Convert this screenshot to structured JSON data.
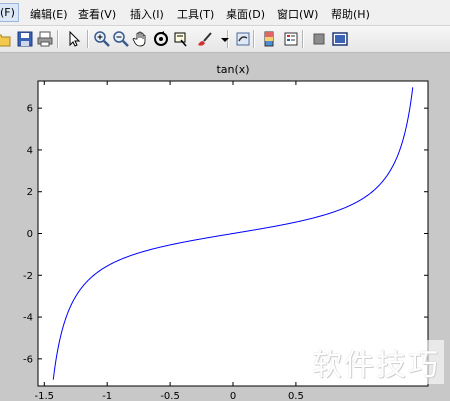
{
  "menu": {
    "items": [
      {
        "label": "文件(F)",
        "visible": "(F)",
        "active": true
      },
      {
        "label": "编辑(E)",
        "visible": "编辑(E)"
      },
      {
        "label": "查看(V)",
        "visible": "查看(V)"
      },
      {
        "label": "插入(I)",
        "visible": "插入(I)"
      },
      {
        "label": "工具(T)",
        "visible": "工具(T)"
      },
      {
        "label": "桌面(D)",
        "visible": "桌面(D)"
      },
      {
        "label": "窗口(W)",
        "visible": "窗口(W)"
      },
      {
        "label": "帮助(H)",
        "visible": "帮助(H)"
      }
    ]
  },
  "toolbar": {
    "icons": [
      "open-file-icon",
      "save-icon",
      "print-icon",
      "pointer-icon",
      "zoom-in-icon",
      "zoom-out-icon",
      "pan-hand-icon",
      "rotate-3d-icon",
      "data-cursor-icon",
      "brush-icon",
      "brush-dropdown-icon",
      "link-plot-icon",
      "colorbar-icon",
      "legend-icon",
      "hide-plot-tools-icon",
      "show-plot-tools-icon"
    ]
  },
  "watermark": "软件技巧",
  "chart_data": {
    "type": "line",
    "title": "tan(x)",
    "function": "tan(x)",
    "x_ticks": [
      "-1.5",
      "-1",
      "-0.5",
      "0",
      "0.5"
    ],
    "y_ticks": [
      "6",
      "4",
      "2",
      "0",
      "-2",
      "-4",
      "-6"
    ],
    "xlim": [
      -1.55,
      1.55
    ],
    "ylim": [
      -7.3,
      7.3
    ],
    "x_domain": [
      -1.4289,
      1.4289
    ],
    "line_color": "#0000ff",
    "grid": false
  }
}
